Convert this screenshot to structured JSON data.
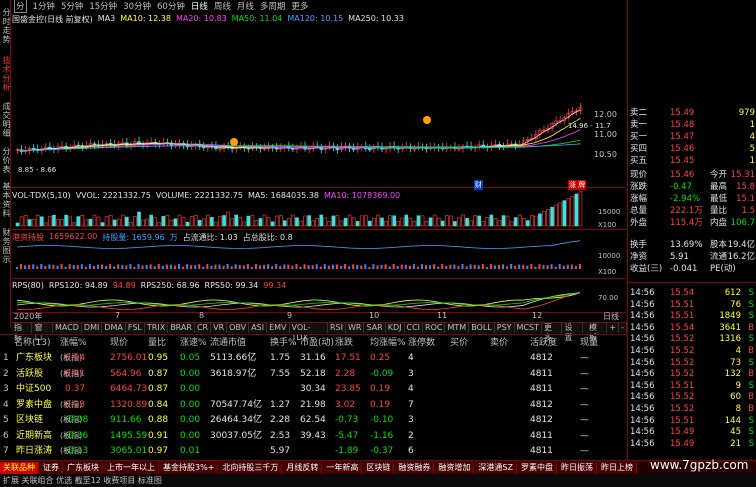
{
  "top_tabs": [
    "分",
    "1分钟",
    "5分钟",
    "15分钟",
    "30分钟",
    "60分钟",
    "日线",
    "周线",
    "月线",
    "多周期",
    "更多"
  ],
  "side_tabs": [
    "分时走势",
    "技术分析",
    "成交明细",
    "分价表",
    "基本资料",
    "财务图示"
  ],
  "stock_title": "国盛金控(日线 前复权)",
  "ma_legend": [
    {
      "t": "MA3",
      "c": "#e0e0e0"
    },
    {
      "t": "MA10: 12.38",
      "c": "#ffff40"
    },
    {
      "t": "MA20: 10.83",
      "c": "#ff40ff"
    },
    {
      "t": "MA50: 11.04",
      "c": "#00e000"
    },
    {
      "t": "MA120: 10.15",
      "c": "#40a0ff"
    },
    {
      "t": "MA250: 10.33",
      "c": "#e0e0e0"
    }
  ],
  "price_axis": [
    "12.00",
    "11.00",
    "10.50"
  ],
  "price_labels": {
    "high": "14.96 - 11.7",
    "low": "8.85 - 8.66",
    "cai": "财",
    "cai2": "涨 牌"
  },
  "vol_legend": [
    {
      "t": "VOL-TDX(5,10)",
      "c": "#e0e0e0"
    },
    {
      "t": "VVOL: 2221332.75",
      "c": "#e0e0e0"
    },
    {
      "t": "VOLUME: 2221332.75",
      "c": "#e0e0e0"
    },
    {
      "t": "MA5: 1684035.38",
      "c": "#e0e0e0"
    },
    {
      "t": "MA10: 1078369.00",
      "c": "#ff40ff"
    }
  ],
  "vol_axis": [
    "15000",
    "10000",
    "X100"
  ],
  "flow_legend": [
    {
      "t": "港资持股",
      "c": "#ff4040"
    },
    {
      "t": "1659622.00",
      "c": "#ff4040"
    },
    {
      "t": "持股量: 1659.96",
      "c": "#40a0ff"
    },
    {
      "t": "万",
      "c": "#40a0ff"
    },
    {
      "t": "占流通比: 1.03",
      "c": "#e0e0e0"
    },
    {
      "t": "占总股比: 0.8",
      "c": "#e0e0e0"
    }
  ],
  "flow_axis": [
    "10000",
    "X100"
  ],
  "rps_legend": [
    {
      "t": "RPS(80)",
      "c": "#e0e0e0"
    },
    {
      "t": "RPS120: 94.89",
      "c": "#e0e0e0"
    },
    {
      "t": "94.89",
      "c": "#ff4040"
    },
    {
      "t": "RPS250: 68.96",
      "c": "#e0e0e0"
    },
    {
      "t": "RPS50: 99.34",
      "c": "#e0e0e0"
    },
    {
      "t": "99.34",
      "c": "#ff4040"
    }
  ],
  "rps_axis": [
    "70.00"
  ],
  "date_axis": [
    "2020年",
    "7",
    "8",
    "9",
    "10",
    "11",
    "12",
    "日线"
  ],
  "ind_tabs": [
    "指标",
    "窗口",
    "MACD",
    "DMI",
    "DMA",
    "FSL",
    "TRIX",
    "BRAR",
    "CR",
    "VR",
    "OBV",
    "ASI",
    "EMV",
    "VOL-TDX",
    "RSI",
    "WR",
    "SAR",
    "KDJ",
    "CCI",
    "ROC",
    "MTM",
    "BOLL",
    "PSY",
    "MCST",
    "更多",
    "设置"
  ],
  "ind_right": [
    "模板",
    "+",
    "-"
  ],
  "quote": {
    "rows": [
      {
        "l": "卖二",
        "v": "15.49",
        "n": "979"
      },
      {
        "l": "卖一",
        "v": "15.48",
        "n": "1"
      },
      {
        "l": "买一",
        "v": "15.47",
        "n": "4"
      },
      {
        "l": "买四",
        "v": "15.46",
        "n": "5"
      },
      {
        "l": "买五",
        "v": "15.45",
        "n": "1"
      }
    ],
    "stats": [
      {
        "a": "现价",
        "av": "15.46",
        "b": "今开",
        "bv": "15.31"
      },
      {
        "a": "涨跌",
        "av": "-0.47",
        "b": "最高",
        "bv": "15.8"
      },
      {
        "a": "涨幅",
        "av": "-2.94%",
        "b": "最低",
        "bv": "15.1"
      },
      {
        "a": "总量",
        "av": "222.1万",
        "b": "量比",
        "bv": "1.5"
      },
      {
        "a": "外盘",
        "av": "115.4万",
        "b": "内盘",
        "bv": "106.7"
      }
    ],
    "stats2": [
      {
        "a": "换手",
        "av": "13.69%",
        "b": "股本",
        "bv": "19.4亿"
      },
      {
        "a": "净资",
        "av": "5.91",
        "b": "流通",
        "bv": "16.2亿"
      },
      {
        "a": "收益(三)",
        "av": "-0.041",
        "b": "PE(动)",
        "bv": ""
      }
    ],
    "ticks": [
      {
        "t": "14:56",
        "p": "15.54",
        "v": "612",
        "d": "S"
      },
      {
        "t": "14:56",
        "p": "15.51",
        "v": "76",
        "d": "S"
      },
      {
        "t": "14:56",
        "p": "15.51",
        "v": "1849",
        "d": "S"
      },
      {
        "t": "14:56",
        "p": "15.54",
        "v": "3641",
        "d": "B"
      },
      {
        "t": "14:56",
        "p": "15.52",
        "v": "1316",
        "d": "S"
      },
      {
        "t": "14:56",
        "p": "15.52",
        "v": "4",
        "d": "B"
      },
      {
        "t": "14:56",
        "p": "15.52",
        "v": "73",
        "d": "S"
      },
      {
        "t": "14:56",
        "p": "15.52",
        "v": "132",
        "d": "B"
      },
      {
        "t": "14:56",
        "p": "15.51",
        "v": "9",
        "d": "S"
      },
      {
        "t": "14:56",
        "p": "15.52",
        "v": "60",
        "d": "B"
      },
      {
        "t": "14:56",
        "p": "15.52",
        "v": "8",
        "d": "B"
      },
      {
        "t": "14:56",
        "p": "15.51",
        "v": "144",
        "d": "S"
      },
      {
        "t": "14:56",
        "p": "15.49",
        "v": "45",
        "d": "S"
      },
      {
        "t": "14:56",
        "p": "15.49",
        "v": "21",
        "d": "S"
      }
    ]
  },
  "table": {
    "headers": [
      "名称(13)",
      "涨幅%",
      "现价",
      "量比",
      "涨速%",
      "流通市值",
      "换手%",
      "市盈(动)",
      "涨跌",
      "均涨幅%",
      "涨停数",
      "买价",
      "卖价",
      "活跃度",
      "现量"
    ],
    "rows": [
      [
        "1",
        "广东板块",
        "(板指)",
        "0.64",
        "2756.01",
        "0.95",
        "0.05",
        "5113.66亿",
        "1.75",
        "31.16",
        "17.51",
        "0.25",
        "4",
        "",
        "",
        "4812",
        "—"
      ],
      [
        "2",
        "活跃股",
        "(板指)",
        "0.41",
        "564.96",
        "0.87",
        "0.00",
        "3618.97亿",
        "7.55",
        "52.18",
        "2.28",
        "-0.09",
        "3",
        "",
        "",
        "4811",
        "—"
      ],
      [
        "3",
        "中证500",
        "",
        "0.37",
        "6464.73",
        "0.87",
        "0.00",
        "",
        "",
        "30.34",
        "23.85",
        "0.19",
        "4",
        "",
        "",
        "4811",
        "—"
      ],
      [
        "4",
        "罗素中盘",
        "(板指)",
        "0.23",
        "1320.89",
        "0.84",
        "0.00",
        "70547.74亿",
        "1.27",
        "21.98",
        "3.02",
        "0.19",
        "7",
        "",
        "",
        "4812",
        "—"
      ],
      [
        "5",
        "区块链",
        "(板指)",
        "-0.08",
        "911.66",
        "0.88",
        "0.00",
        "26464.34亿",
        "2.28",
        "62.54",
        "-0.73",
        "-0.10",
        "3",
        "",
        "",
        "4812",
        "—"
      ],
      [
        "6",
        "近期新高",
        "(板指)",
        "-0.36",
        "1495.59",
        "0.91",
        "0.00",
        "30037.05亿",
        "2.53",
        "39.43",
        "-5.47",
        "-1.16",
        "2",
        "",
        "",
        "4811",
        "—"
      ],
      [
        "7",
        "昨日涨涛",
        "(板指)",
        "-0.13",
        "3065.01",
        "0.97",
        "0.01",
        "",
        "5.97",
        "",
        "-1.89",
        "-0.37",
        "6",
        "",
        "",
        "4811",
        "—"
      ]
    ]
  },
  "bottom_tabs": [
    "关联品种",
    "证券",
    "广东板块",
    "上市一年以上",
    "基金持股3%+",
    "北向持股三千万",
    "月线反转",
    "一年新高",
    "区块链",
    "融资融券",
    "融资增加",
    "深港通SZ",
    "罗素中盘",
    "昨日振荡",
    "昨日上榜"
  ],
  "status_text": "扩展 关联组合 优选 截至12 收费项目 标准图",
  "watermark": "www.7gpzb.com"
}
